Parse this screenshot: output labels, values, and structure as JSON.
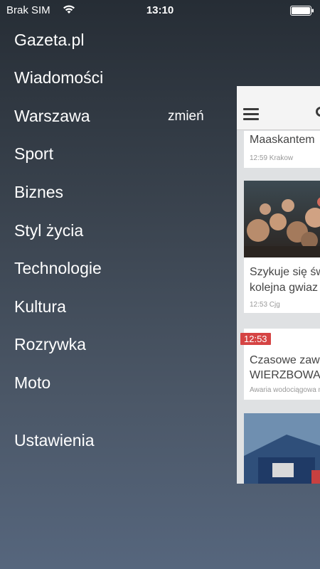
{
  "status_bar": {
    "carrier": "Brak SIM",
    "time": "13:10",
    "wifi_icon": "wifi-icon",
    "battery_icon": "battery-icon"
  },
  "menu": {
    "items": [
      {
        "label": "Gazeta.pl"
      },
      {
        "label": "Wiadomości"
      },
      {
        "label": "Warszawa"
      },
      {
        "label": "Sport"
      },
      {
        "label": "Biznes"
      },
      {
        "label": "Styl życia"
      },
      {
        "label": "Technologie"
      },
      {
        "label": "Kultura"
      },
      {
        "label": "Rozrywka"
      },
      {
        "label": "Moto"
      }
    ],
    "settings_label": "Ustawienia",
    "change_label": "zmień"
  },
  "content_preview": {
    "menu_icon": "hamburger-icon",
    "search_icon": "search-icon",
    "cards": [
      {
        "title_line": "Maaskantem",
        "meta": "12:59 Krakow"
      },
      {
        "title_line1": "Szykuje się św",
        "title_line2": "kolejna gwiaz",
        "meta": "12:53 Cjg"
      },
      {
        "badge": "12:53",
        "title_line1": "Czasowe zaw",
        "title_line2": "WIERZBOWA",
        "meta": "Awaria wodociągowa n"
      }
    ]
  },
  "colors": {
    "background_top": "#262d35",
    "background_bottom": "#56667d",
    "badge": "#d54444"
  }
}
